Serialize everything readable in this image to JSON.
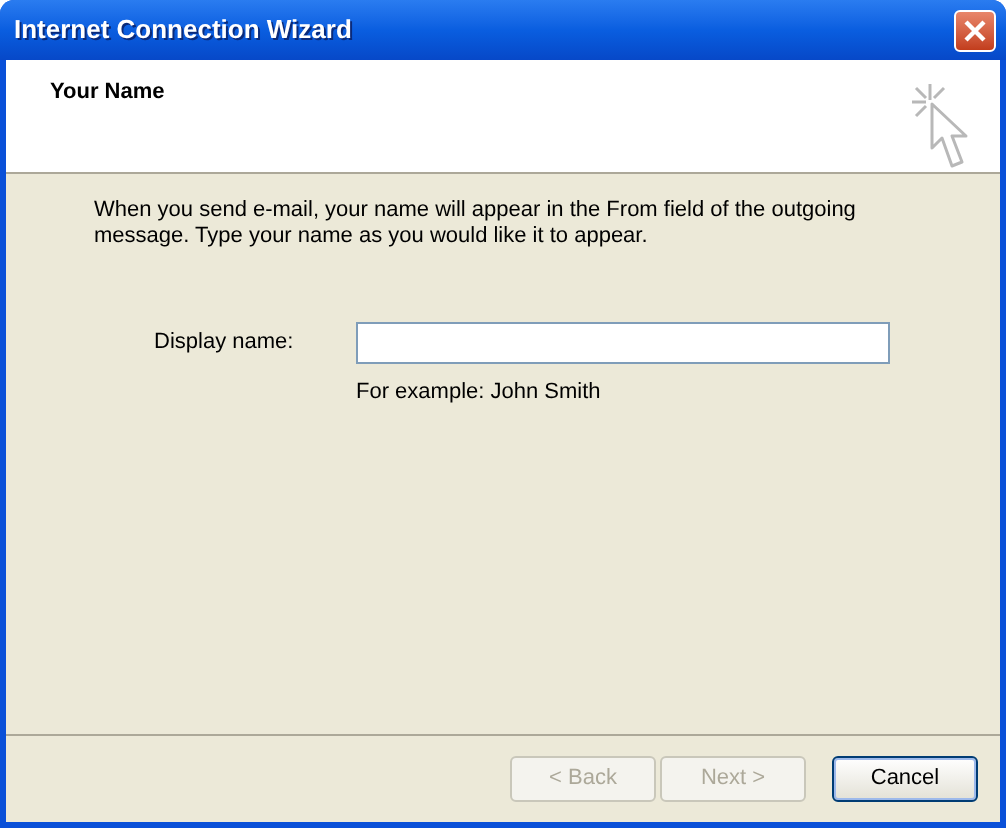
{
  "window": {
    "title": "Internet Connection Wizard"
  },
  "header": {
    "title": "Your Name"
  },
  "intro": "When you send e-mail, your name will appear in the From field of the outgoing message. Type your name as you would like it to appear.",
  "field": {
    "label": "Display name:",
    "hint": "For example: John Smith"
  },
  "buttons": [
    {
      "label": "< Back",
      "disabled": true,
      "default": false
    },
    {
      "label": "Next >",
      "disabled": true,
      "default": false
    },
    {
      "label": "Cancel",
      "disabled": false,
      "default": true
    }
  ]
}
